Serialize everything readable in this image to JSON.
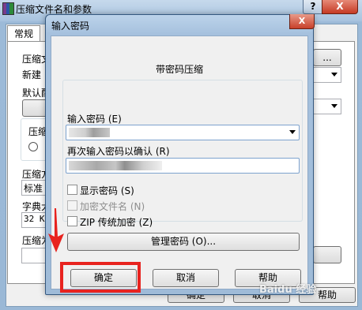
{
  "background_window": {
    "title": "压缩文件名和参数",
    "help_button": "?",
    "close_button": "X",
    "tab_general": "常规",
    "archive_name_label": "压缩文",
    "archive_name_value": "新建",
    "default_label": "默认配",
    "format_group_label": "压缩",
    "method_label": "压缩方",
    "method_value": "标准",
    "dictionary_label": "字典大",
    "dictionary_value": "32 K",
    "split_label": "压缩为",
    "browse_button": "...",
    "ok_button": "确定",
    "cancel_button": "取消",
    "help_btn": "帮助"
  },
  "dialog": {
    "title": "输入密码",
    "close_button": "X",
    "heading": "带密码压缩",
    "password_label": "输入密码 (E)",
    "confirm_label": "再次输入密码以确认 (R)",
    "options": [
      {
        "label": "显示密码 (S)",
        "checked": false,
        "enabled": true
      },
      {
        "label": "加密文件名 (N)",
        "checked": false,
        "enabled": false
      },
      {
        "label": "ZIP 传统加密 (Z)",
        "checked": false,
        "enabled": true
      }
    ],
    "manage_button": "管理密码 (O)...",
    "ok_button": "确定",
    "cancel_button": "取消",
    "help_button": "帮助"
  },
  "annotation": {
    "highlight_color": "#e8231f"
  },
  "watermark": "Baidu 经验"
}
